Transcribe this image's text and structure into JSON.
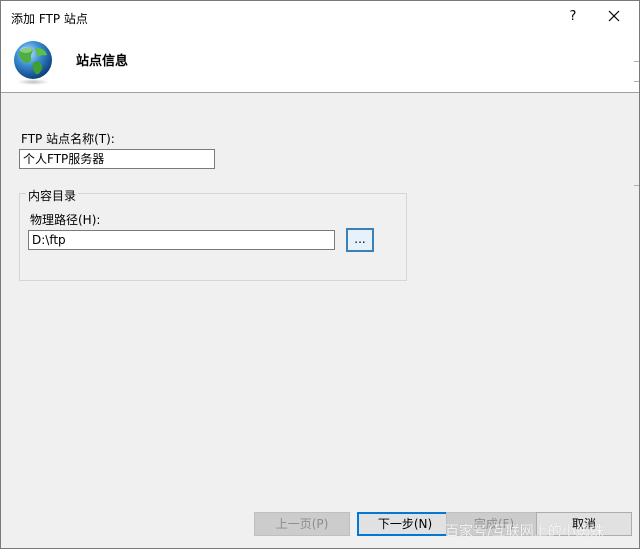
{
  "window": {
    "title": "添加 FTP 站点",
    "help_label": "?",
    "close_icon": "close-icon"
  },
  "header": {
    "title": "站点信息",
    "icon": "globe-icon"
  },
  "form": {
    "site_name_label": "FTP 站点名称(T):",
    "site_name_value": "个人FTP服务器",
    "content_group_label": "内容目录",
    "physical_path_label": "物理路径(H):",
    "physical_path_value": "D:\\ftp",
    "browse_label": "..."
  },
  "buttons": {
    "prev_label": "上一页(P)",
    "next_label": "下一步(N)",
    "finish_label": "完成(F)",
    "cancel_label": "取消"
  },
  "watermark": {
    "text": "百家号/互联网上的小蜘蛛"
  },
  "colors": {
    "dialog_bg": "#f0f0f0",
    "header_bg": "#ffffff",
    "focus_border": "#3c7fb1",
    "default_button_border": "#0078d7"
  }
}
